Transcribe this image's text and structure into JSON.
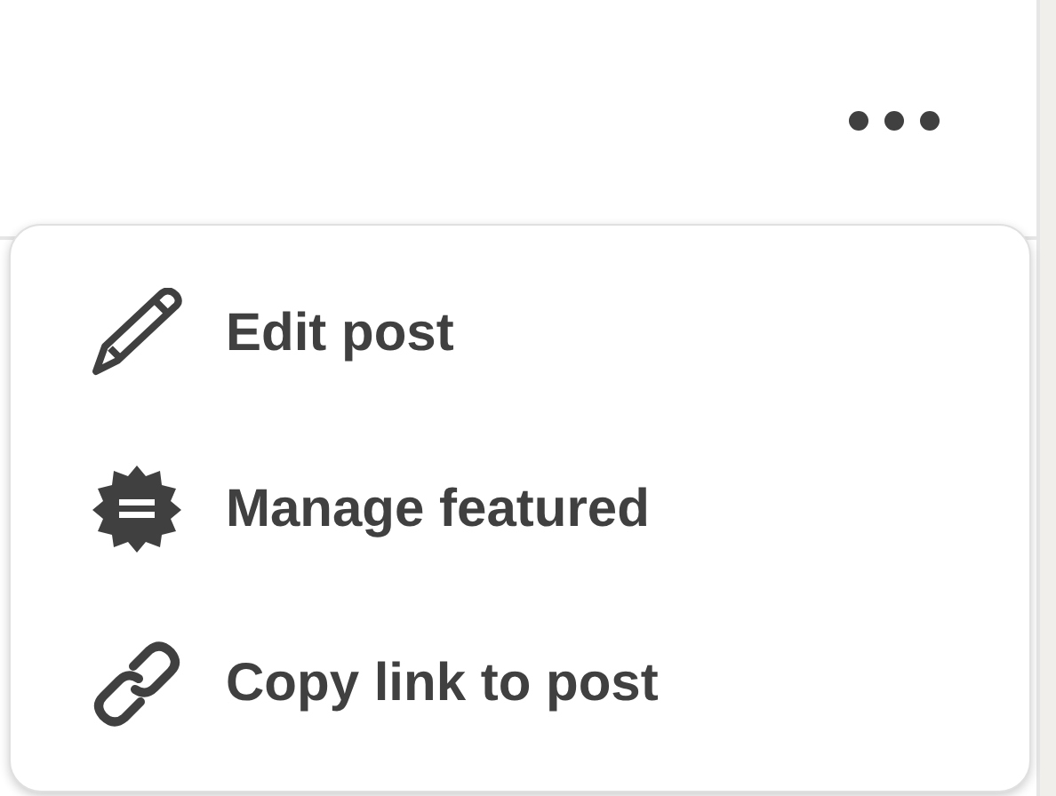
{
  "menu": {
    "items": [
      {
        "kind": "edit",
        "label": "Edit post"
      },
      {
        "kind": "featured",
        "label": "Manage featured"
      },
      {
        "kind": "link",
        "label": "Copy link to post"
      }
    ]
  }
}
